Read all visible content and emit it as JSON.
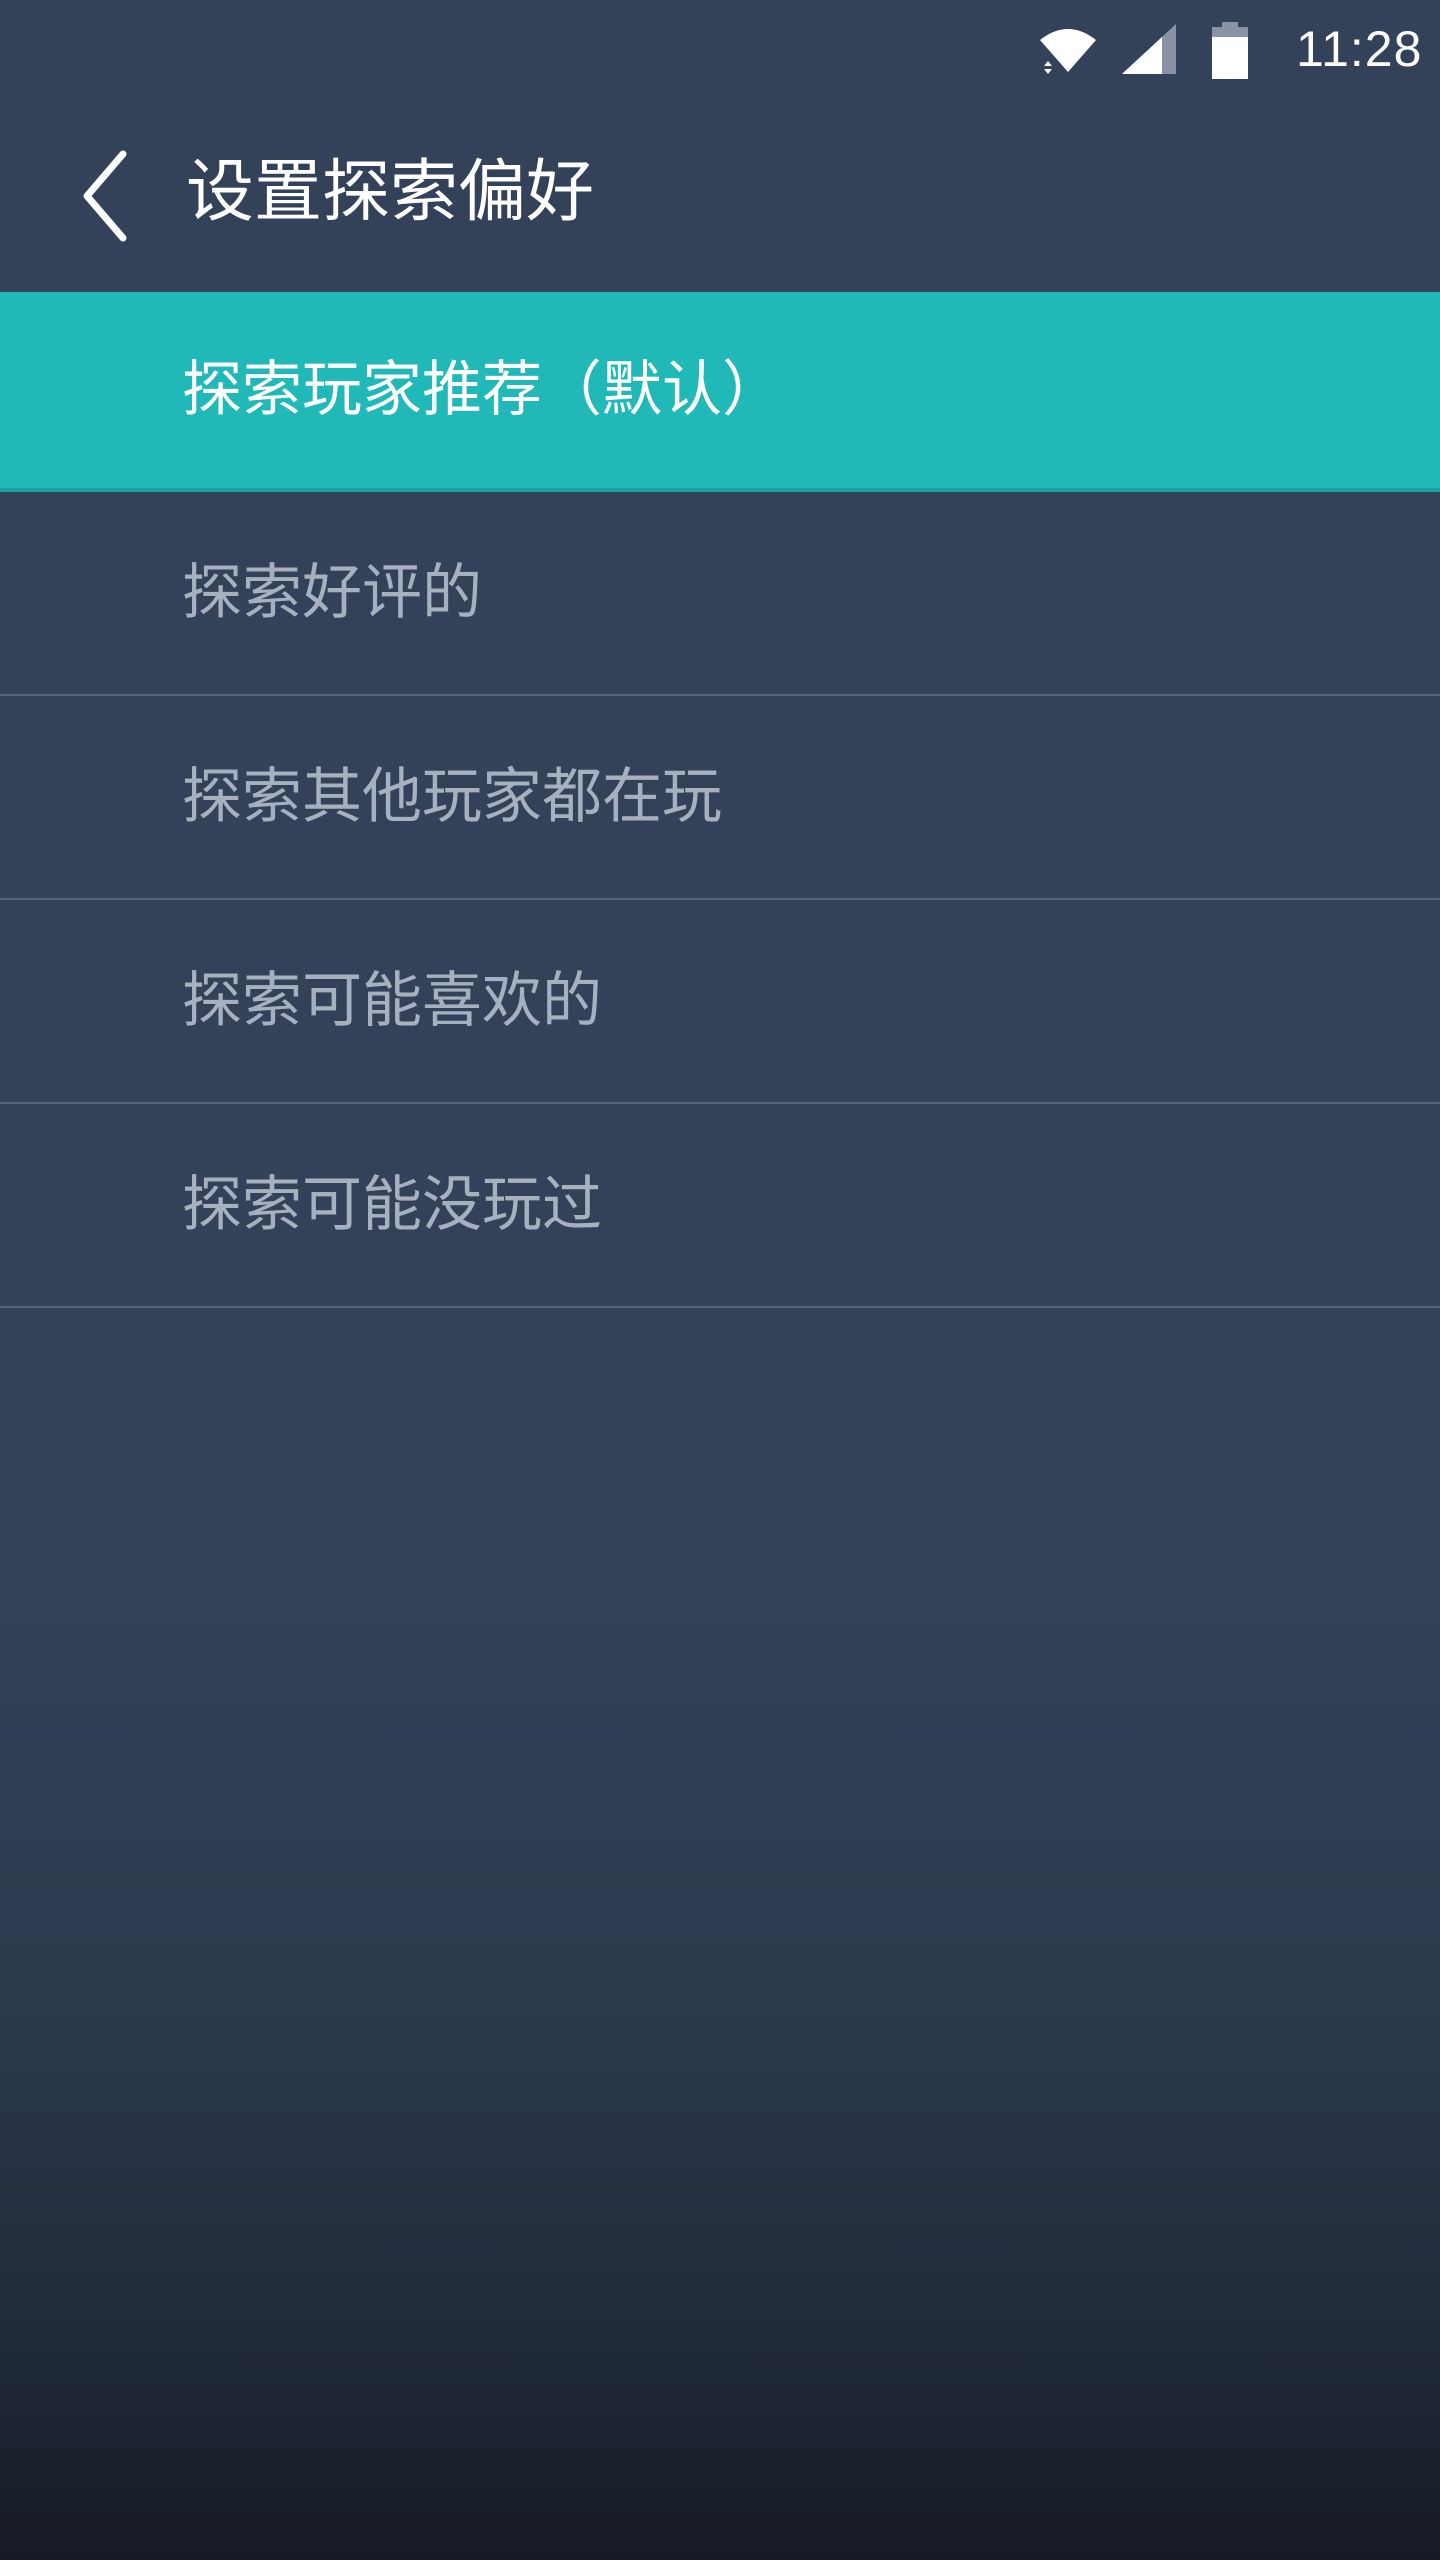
{
  "status_bar": {
    "time": "11:28",
    "icons": [
      "wifi-icon",
      "cell-signal-icon",
      "battery-icon"
    ]
  },
  "header": {
    "back_icon": "chevron-left-icon",
    "title": "设置探索偏好"
  },
  "menu": {
    "items": [
      {
        "label": "探索玩家推荐（默认）",
        "selected": true
      },
      {
        "label": "探索好评的",
        "selected": false
      },
      {
        "label": "探索其他玩家都在玩",
        "selected": false
      },
      {
        "label": "探索可能喜欢的",
        "selected": false
      },
      {
        "label": "探索可能没玩过",
        "selected": false
      }
    ]
  },
  "colors": {
    "background": "#334259",
    "accent": "#21b8b8",
    "divider": "#56637a",
    "inactive_text": "#a7b0bf"
  }
}
